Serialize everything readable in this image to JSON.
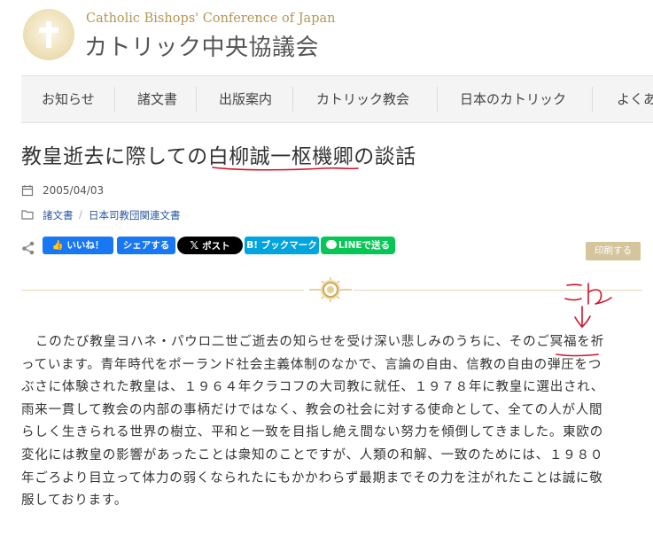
{
  "header": {
    "site_name_en": "Catholic Bishops' Conference of Japan",
    "site_name_ja": "カトリック中央協議会",
    "logo_icon": "cross-icon"
  },
  "nav": {
    "items": [
      {
        "label": "お知らせ"
      },
      {
        "label": "諸文書"
      },
      {
        "label": "出版案内"
      },
      {
        "label": "カトリック教会"
      },
      {
        "label": "日本のカトリック"
      },
      {
        "label": "よくあ"
      }
    ]
  },
  "article": {
    "title": "教皇逝去に際しての白柳誠一枢機卿の談話",
    "date": "2005/04/03",
    "categories": [
      "諸文書",
      "日本司教団関連文書"
    ],
    "body_lines": [
      "このたび教皇ヨハネ・パウロ二世ご逝去の知らせを受け深い悲しみのうちに、そのご冥福を祈",
      "っています。青年時代をポーランド社会主義体制のなかで、言論の自由、信教の自由の弾圧をつ",
      "ぶさに体験された教皇は、１９６４年クラコフの大司教に就任、１９７８年に教皇に選出され、",
      "雨来一貫して教会の内部の事柄だけではなく、教会の社会に対する使命として、全ての人が人間",
      "らしく生きられる世界の樹立、平和と一致を目指し絶え間ない努力を傾倒してきました。東欧の",
      "変化には教皇の影響があったことは衆知のことですが、人類の和解、一致のためには、１９８０",
      "年ごろより目立って体力の弱くなられたにもかかわらず最期までその力を注がれたことは誠に敬",
      "服しております。"
    ]
  },
  "share": {
    "facebook_like": "いいね！",
    "facebook_share": "シェアする",
    "x_post": "ポスト",
    "hatena": "ブックマーク",
    "line": "LINEで送る",
    "print": "印刷する"
  },
  "colors": {
    "gold": "#b39753",
    "link": "#2a58a0",
    "annotation_red": "#d0142c"
  }
}
